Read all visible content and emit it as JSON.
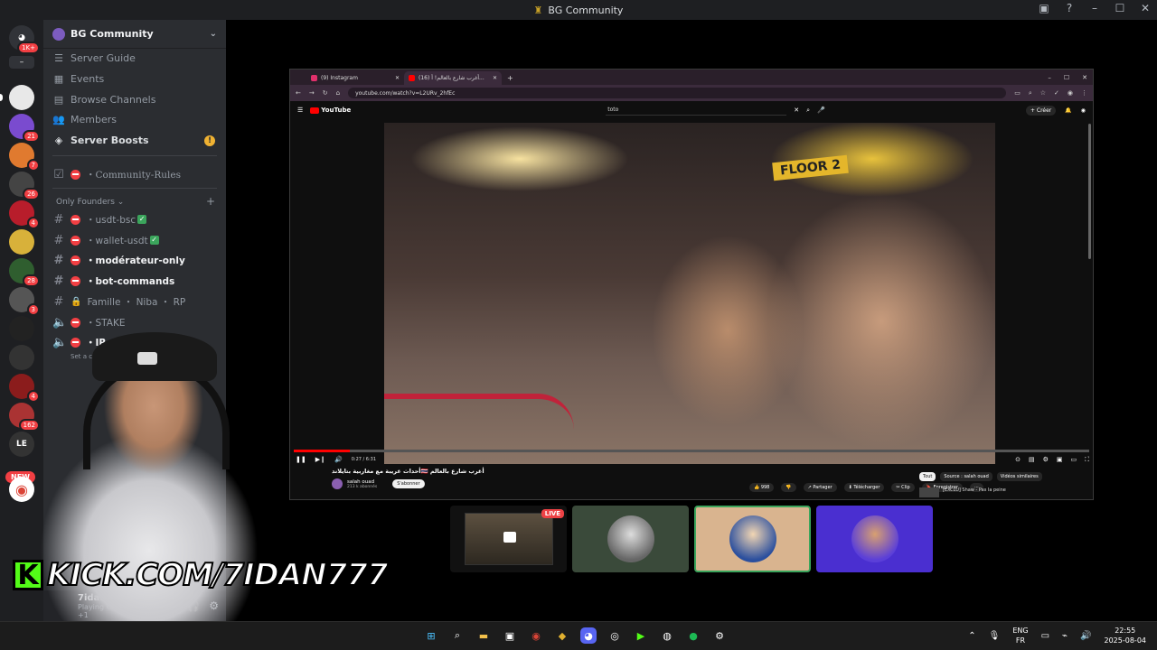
{
  "window": {
    "title": "BG Community"
  },
  "servers": {
    "badges": [
      "1K+",
      "21",
      "7",
      "26",
      "4",
      "28",
      "3",
      "4",
      "162"
    ],
    "new_label": "NEW",
    "named": [
      "LE"
    ]
  },
  "guild": {
    "name": "BG Community",
    "nav": [
      {
        "label": "Server Guide",
        "icon": "server-guide-icon"
      },
      {
        "label": "Events",
        "icon": "calendar-icon"
      },
      {
        "label": "Browse Channels",
        "icon": "browse-channels-icon"
      },
      {
        "label": "Members",
        "icon": "members-icon"
      },
      {
        "label": "Server Boosts",
        "icon": "boost-icon"
      }
    ],
    "boost_alert": "!",
    "rules_channel": "・Community-Rules",
    "category": "Only Founders",
    "channels": [
      {
        "name": "・usdt-bsc",
        "type": "text",
        "check": "✓"
      },
      {
        "name": "・wallet-usdt",
        "type": "text",
        "check": "✓"
      },
      {
        "name": "・modérateur-only",
        "type": "text"
      },
      {
        "name": "・bot-commands",
        "type": "text"
      },
      {
        "name": "Famille ・ Niba ・ RP",
        "type": "locked"
      },
      {
        "name": "・STAKE",
        "type": "voice"
      },
      {
        "name": "・IR",
        "type": "voice"
      }
    ],
    "voice_hint": "Set a ch"
  },
  "user": {
    "name": "7idaaan",
    "status": "Playing Google Chrome +1"
  },
  "browser": {
    "tabs": [
      {
        "label": "(9) Instagram",
        "color": "#e1306c"
      },
      {
        "label": "(16) أغرب شارع بالعالم! أ...",
        "color": "#ff0000"
      }
    ],
    "url": "youtube.com/watch?v=L2URv_2hfEc",
    "yt_logo": "YouTube",
    "search_value": "toto",
    "create_label": "+ Créer",
    "time": "0:27 / 6:31",
    "progress": 0.07,
    "video_title": "أحداث غريبة مع مغاربية بتايلاند🇹🇭 أغرب شارع بالعالم",
    "channel": "salah ouad",
    "subs": "213 k abonnés",
    "subscribe": "S'abonner",
    "actions": [
      "👍 998",
      "👎",
      "↗ Partager",
      "⬇ Télécharger",
      "✂ Clip",
      "🔖 Enregistrer",
      "⋯"
    ],
    "chips": [
      "Tout",
      "Source : salah ouad",
      "Vidéos similaires"
    ],
    "suggestion": "[EXCLU] Shaw - Pas la peine",
    "floor_sign": "FLOOR 2"
  },
  "call": {
    "live_label": "LIVE"
  },
  "overlay": {
    "kick_k": "K",
    "kick_text": "KICK.COM/7IDAN777"
  },
  "taskbar": {
    "lang_top": "ENG",
    "lang_bottom": "FR",
    "time": "22:55",
    "date": "2025-08-04"
  },
  "colors": {
    "discord_bg": "#2b2d31",
    "rail_bg": "#1e1f22",
    "red": "#f23f43",
    "kick_green": "#53fc18",
    "yt_red": "#ff0000"
  }
}
